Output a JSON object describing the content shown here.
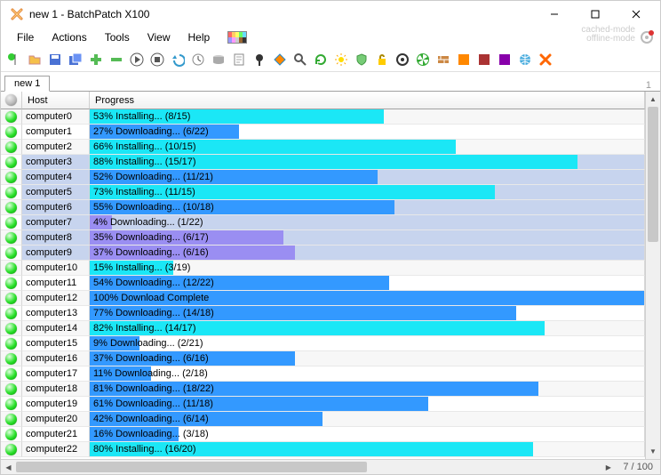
{
  "window": {
    "title": "new 1 - BatchPatch X100"
  },
  "menu": {
    "file": "File",
    "actions": "Actions",
    "tools": "Tools",
    "view": "View",
    "help": "Help"
  },
  "mode": {
    "line1": "cached-mode",
    "line2": "offline-mode"
  },
  "tabs": {
    "active": "new 1",
    "count_label": "1"
  },
  "columns": {
    "host": "Host",
    "progress": "Progress"
  },
  "status": {
    "range": "7 / 100"
  },
  "colors": {
    "cyan": "#1BE7F6",
    "blue": "#3399FF",
    "purple": "#9A8EF2"
  },
  "rows": [
    {
      "host": "computer0",
      "pct": 53,
      "text": "53% Installing... (8/15)",
      "color": "cyan"
    },
    {
      "host": "computer1",
      "pct": 27,
      "text": "27% Downloading... (6/22)",
      "color": "blue"
    },
    {
      "host": "computer2",
      "pct": 66,
      "text": "66% Installing... (10/15)",
      "color": "cyan"
    },
    {
      "host": "computer3",
      "pct": 88,
      "text": "88% Installing... (15/17)",
      "color": "cyan"
    },
    {
      "host": "computer4",
      "pct": 52,
      "text": "52% Downloading... (11/21)",
      "color": "blue"
    },
    {
      "host": "computer5",
      "pct": 73,
      "text": "73% Installing... (11/15)",
      "color": "cyan"
    },
    {
      "host": "computer6",
      "pct": 55,
      "text": "55% Downloading... (10/18)",
      "color": "blue"
    },
    {
      "host": "computer7",
      "pct": 4,
      "text": "4% Downloading... (1/22)",
      "color": "purple"
    },
    {
      "host": "computer8",
      "pct": 35,
      "text": "35% Downloading... (6/17)",
      "color": "purple"
    },
    {
      "host": "computer9",
      "pct": 37,
      "text": "37% Downloading... (6/16)",
      "color": "purple"
    },
    {
      "host": "computer10",
      "pct": 15,
      "text": "15% Installing... (3/19)",
      "color": "cyan"
    },
    {
      "host": "computer11",
      "pct": 54,
      "text": "54% Downloading... (12/22)",
      "color": "blue"
    },
    {
      "host": "computer12",
      "pct": 100,
      "text": "100% Download Complete",
      "color": "blue"
    },
    {
      "host": "computer13",
      "pct": 77,
      "text": "77% Downloading... (14/18)",
      "color": "blue"
    },
    {
      "host": "computer14",
      "pct": 82,
      "text": "82% Installing... (14/17)",
      "color": "cyan"
    },
    {
      "host": "computer15",
      "pct": 9,
      "text": "9% Downloading... (2/21)",
      "color": "blue"
    },
    {
      "host": "computer16",
      "pct": 37,
      "text": "37% Downloading... (6/16)",
      "color": "blue"
    },
    {
      "host": "computer17",
      "pct": 11,
      "text": "11% Downloading... (2/18)",
      "color": "blue"
    },
    {
      "host": "computer18",
      "pct": 81,
      "text": "81% Downloading... (18/22)",
      "color": "blue"
    },
    {
      "host": "computer19",
      "pct": 61,
      "text": "61% Downloading... (11/18)",
      "color": "blue"
    },
    {
      "host": "computer20",
      "pct": 42,
      "text": "42% Downloading... (6/14)",
      "color": "blue"
    },
    {
      "host": "computer21",
      "pct": 16,
      "text": "16% Downloading... (3/18)",
      "color": "blue"
    },
    {
      "host": "computer22",
      "pct": 80,
      "text": "80% Installing... (16/20)",
      "color": "cyan"
    }
  ],
  "selected_rows": [
    3,
    4,
    5,
    6,
    7,
    8,
    9
  ],
  "toolbar_icons": [
    "flag",
    "folder",
    "save",
    "saveall",
    "plus",
    "minus",
    "play",
    "stop",
    "undo",
    "clock",
    "disk",
    "page",
    "pin",
    "diamond",
    "mag",
    "refresh",
    "sun",
    "shield",
    "unlock",
    "target",
    "fan",
    "brick",
    "orange",
    "red",
    "purple",
    "globe",
    "x"
  ]
}
